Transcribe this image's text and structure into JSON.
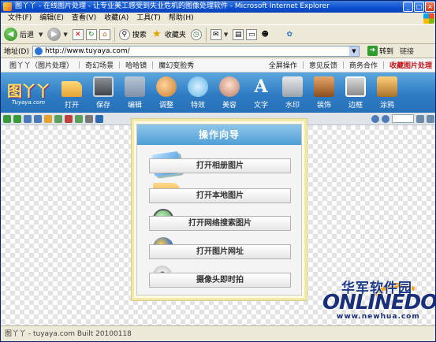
{
  "window": {
    "title": "图丫丫 - 在线图片处理 - 让专业美工感受到失业危机的图像处理软件 - Microsoft Internet Explorer",
    "minimize": "_",
    "maximize": "□",
    "close": "×"
  },
  "menu": [
    "文件(F)",
    "编辑(E)",
    "查看(V)",
    "收藏(A)",
    "工具(T)",
    "帮助(H)"
  ],
  "toolbar": {
    "back_label": "后退",
    "search_label": "搜索",
    "favorites_label": "收藏夹"
  },
  "address": {
    "label": "地址(D)",
    "url": "http://www.tuyaya.com/",
    "go_label": "转到",
    "links_label": "链接"
  },
  "webnav": {
    "left": [
      "图丫丫（图片处理）",
      "奇幻场景",
      "哈哈镜",
      "魔幻变脸秀"
    ],
    "right": [
      "全屏操作",
      "意见反馈",
      "商务合作"
    ],
    "highlight": "收藏图片处理"
  },
  "app": {
    "logo_mark": "图丫丫",
    "logo_sub": "Tuyaya.com",
    "tools": [
      "打开",
      "保存",
      "编辑",
      "调整",
      "特效",
      "美容",
      "文字",
      "水印",
      "装饰",
      "边框",
      "涂鸦"
    ]
  },
  "dialog": {
    "title": "操作向导",
    "buttons": [
      "打开相册图片",
      "打开本地图片",
      "打开网络搜索图片",
      "打开图片网址",
      "摄像头即时拍"
    ]
  },
  "watermark": {
    "cn": "华军软件园",
    "en": "ONLINEDOWN",
    "url": "www.newhua.com"
  },
  "status": "图丫丫 - tuyaya.com  Built 20100118"
}
